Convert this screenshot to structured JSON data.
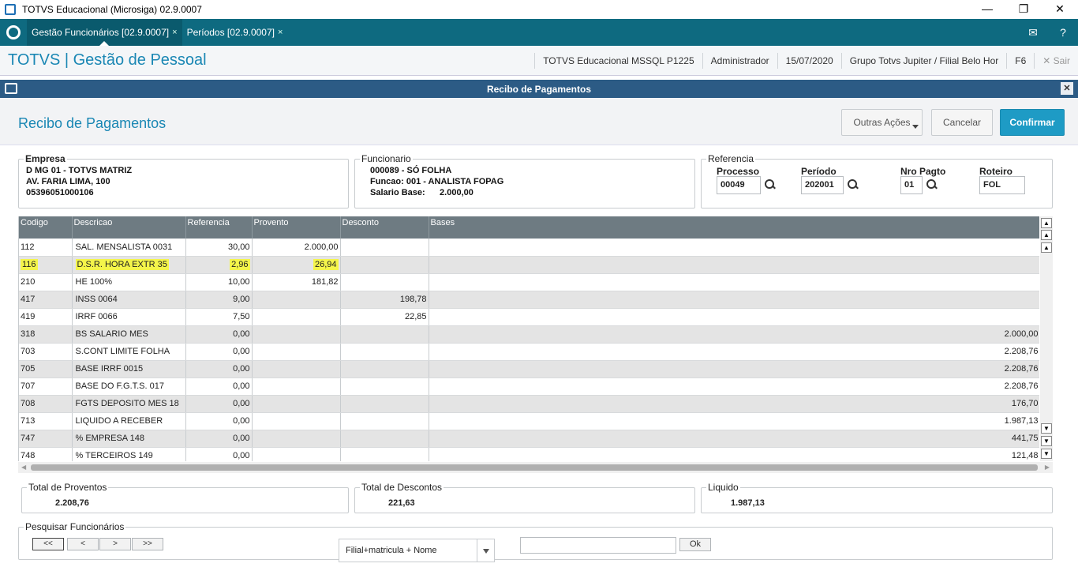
{
  "window": {
    "title": "TOTVS Educacional (Microsiga) 02.9.0007",
    "minimize": "—",
    "restore": "❐",
    "close": "✕"
  },
  "tabs": [
    {
      "label": "Gestão Funcionários [02.9.0007]",
      "close": "×"
    },
    {
      "label": "Períodos [02.9.0007]",
      "close": "×"
    }
  ],
  "tabbar_icons": {
    "mail": "✉",
    "help": "?"
  },
  "header": {
    "brand": "TOTVS | Gestão de Pessoal",
    "env": "TOTVS Educacional MSSQL P1225",
    "user": "Administrador",
    "date": "15/07/2020",
    "branch": "Grupo Totvs Jupiter / Filial Belo Hor",
    "shortcut": "F6",
    "exit": "✕  Sair"
  },
  "dialog": {
    "title": "Recibo de Pagamentos",
    "close": "✕"
  },
  "page": {
    "title": "Recibo de Pagamentos",
    "actions": {
      "outras": "Outras Ações",
      "cancel": "Cancelar",
      "confirm": "Confirmar"
    }
  },
  "empresa": {
    "legend": "Empresa",
    "line1": "D MG 01  - TOTVS MATRIZ",
    "line2": "AV. FARIA LIMA, 100",
    "line3": "05396051000106"
  },
  "funcionario": {
    "legend": "Funcionario",
    "line1": "000089 - SÓ FOLHA",
    "line2": "Funcao: 001    - ANALISTA FOPAG",
    "line3": "Salario Base:      2.000,00"
  },
  "referencia": {
    "legend": "Referencia",
    "processo_label": "Processo",
    "processo": "00049",
    "periodo_label": "Período",
    "periodo": "202001",
    "nropagto_label": "Nro Pagto",
    "nropagto": "01",
    "roteiro_label": "Roteiro",
    "roteiro": "FOL"
  },
  "grid": {
    "columns": [
      "Codigo",
      "Descricao",
      "Referencia",
      "Provento",
      "Desconto",
      "Bases"
    ],
    "rows": [
      {
        "codigo": "112",
        "descricao": "SAL. MENSALISTA 0031",
        "referencia": "30,00",
        "provento": "2.000,00",
        "desconto": "",
        "bases": ""
      },
      {
        "codigo": "116",
        "descricao": "D.S.R. HORA EXTR  35",
        "referencia": "2,96",
        "provento": "26,94",
        "desconto": "",
        "bases": ""
      },
      {
        "codigo": "210",
        "descricao": "HE 100%",
        "referencia": "10,00",
        "provento": "181,82",
        "desconto": "",
        "bases": ""
      },
      {
        "codigo": "417",
        "descricao": "INSS 0064",
        "referencia": "9,00",
        "provento": "",
        "desconto": "198,78",
        "bases": ""
      },
      {
        "codigo": "419",
        "descricao": "IRRF 0066",
        "referencia": "7,50",
        "provento": "",
        "desconto": "22,85",
        "bases": ""
      },
      {
        "codigo": "318",
        "descricao": "BS SALARIO MES",
        "referencia": "0,00",
        "provento": "",
        "desconto": "",
        "bases": "2.000,00"
      },
      {
        "codigo": "703",
        "descricao": "S.CONT LIMITE FOLHA",
        "referencia": "0,00",
        "provento": "",
        "desconto": "",
        "bases": "2.208,76"
      },
      {
        "codigo": "705",
        "descricao": "BASE IRRF 0015",
        "referencia": "0,00",
        "provento": "",
        "desconto": "",
        "bases": "2.208,76"
      },
      {
        "codigo": "707",
        "descricao": "BASE DO F.G.T.S. 017",
        "referencia": "0,00",
        "provento": "",
        "desconto": "",
        "bases": "2.208,76"
      },
      {
        "codigo": "708",
        "descricao": "FGTS DEPOSITO MES 18",
        "referencia": "0,00",
        "provento": "",
        "desconto": "",
        "bases": "176,70"
      },
      {
        "codigo": "713",
        "descricao": "LIQUIDO A RECEBER",
        "referencia": "0,00",
        "provento": "",
        "desconto": "",
        "bases": "1.987,13"
      },
      {
        "codigo": "747",
        "descricao": "% EMPRESA  148",
        "referencia": "0,00",
        "provento": "",
        "desconto": "",
        "bases": "441,75"
      },
      {
        "codigo": "748",
        "descricao": "% TERCEIROS 149",
        "referencia": "0,00",
        "provento": "",
        "desconto": "",
        "bases": "121,48"
      }
    ]
  },
  "totals": {
    "proventos_label": "Total de Proventos",
    "proventos": "2.208,76",
    "descontos_label": "Total de Descontos",
    "descontos": "221,63",
    "liquido_label": "Liquido",
    "liquido": "1.987,13"
  },
  "pesquisa": {
    "legend": "Pesquisar Funcionários",
    "first": "<<",
    "prev": "<",
    "next": ">",
    "last": ">>",
    "order": "Filial+matricula + Nome",
    "search_value": "",
    "ok": "Ok"
  }
}
